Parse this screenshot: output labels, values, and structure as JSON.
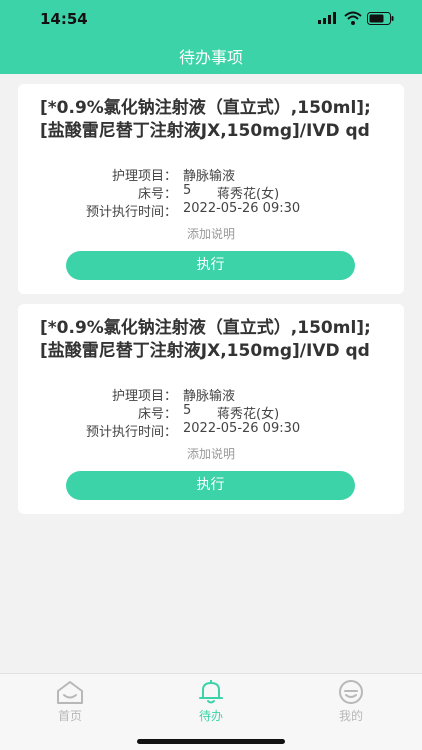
{
  "status": {
    "time": "14:54"
  },
  "header": {
    "title": "待办事项"
  },
  "tasks": [
    {
      "order": "[*0.9%氯化钠注射液（直立式）,150ml];[盐酸雷尼替丁注射液JX,150mg]/IVD qd",
      "nursing_label": "护理项目：",
      "nursing_value": "静脉输液",
      "bed_label": "床号：",
      "bed_value": "5",
      "patient": "蒋秀花(女)",
      "time_label": "预计执行时间：",
      "time_value": "2022-05-26 09:30",
      "note_label": "添加说明",
      "exec_label": "执行"
    },
    {
      "order": "[*0.9%氯化钠注射液（直立式）,150ml];[盐酸雷尼替丁注射液JX,150mg]/IVD qd",
      "nursing_label": "护理项目：",
      "nursing_value": "静脉输液",
      "bed_label": "床号：",
      "bed_value": "5",
      "patient": "蒋秀花(女)",
      "time_label": "预计执行时间：",
      "time_value": "2022-05-26 09:30",
      "note_label": "添加说明",
      "exec_label": "执行"
    }
  ],
  "tabbar": {
    "items": [
      {
        "label": "首页",
        "icon": "home-icon",
        "active": false
      },
      {
        "label": "待办",
        "icon": "bell-icon",
        "active": true
      },
      {
        "label": "我的",
        "icon": "smiley-icon",
        "active": false
      }
    ]
  },
  "colors": {
    "accent": "#3dd3a8",
    "inactive": "#b8b8b8"
  }
}
